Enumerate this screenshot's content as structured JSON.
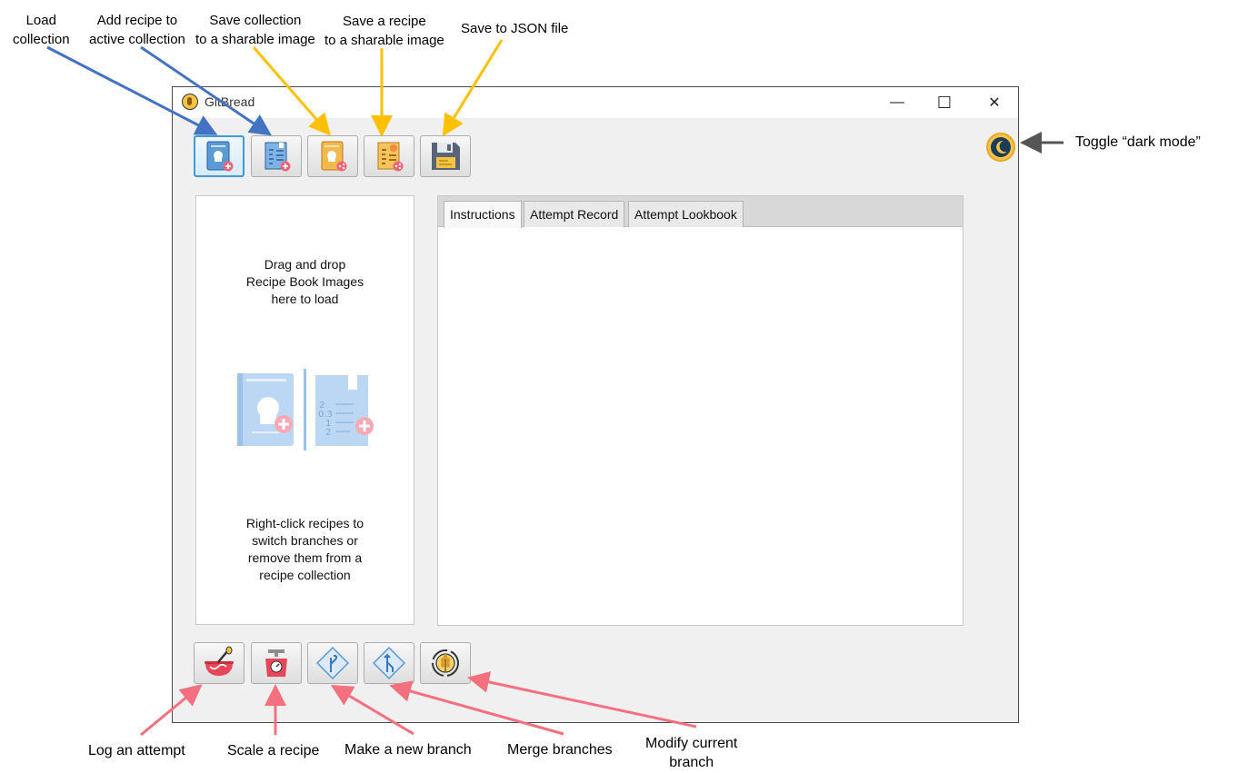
{
  "annotations": {
    "load_collection": "Load\ncollection",
    "add_recipe": "Add recipe to\nactive collection",
    "save_collection_image": "Save collection\nto a sharable image",
    "save_recipe_image": "Save a recipe\nto a sharable image",
    "save_json": "Save to JSON file",
    "toggle_dark": "Toggle “dark mode”",
    "log_attempt": "Log an attempt",
    "scale_recipe": "Scale a recipe",
    "new_branch": "Make a new branch",
    "merge_branches": "Merge branches",
    "modify_branch": "Modify current\nbranch"
  },
  "window": {
    "title": "GitBread",
    "minimize_glyph": "—",
    "maximize_glyph": "☐",
    "close_glyph": "✕"
  },
  "top_toolbar": {
    "icons": [
      "load-collection-icon",
      "add-recipe-icon",
      "save-collection-image-icon",
      "save-recipe-image-icon",
      "floppy-disk-icon"
    ]
  },
  "bottom_toolbar": {
    "icons": [
      "mixing-bowl-icon",
      "kitchen-scale-icon",
      "branch-icon",
      "merge-icon",
      "wheat-cycle-icon"
    ]
  },
  "left_panel": {
    "drop_hint": "Drag and drop\nRecipe Book Images\nhere to load",
    "right_click_hint": "Right-click recipes to\nswitch branches or\nremove them from a\nrecipe collection"
  },
  "tabs": [
    "Instructions",
    "Attempt Record",
    "Attempt Lookbook"
  ],
  "colors": {
    "blue_arrow": "#4472c4",
    "yellow_arrow": "#ffc000",
    "pink_arrow": "#f4707f",
    "gray_arrow": "#555555"
  }
}
